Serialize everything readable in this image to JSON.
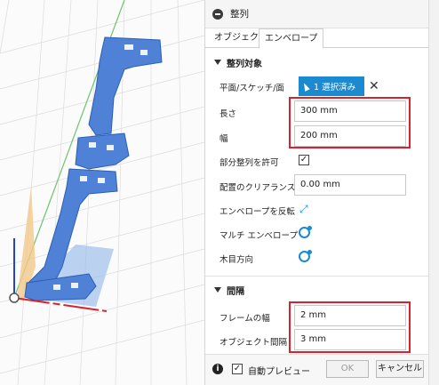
{
  "panel": {
    "title": "整列",
    "tabs": [
      "オブジェクト",
      "エンベロープ"
    ],
    "active_tab": 1
  },
  "section_target": {
    "header": "整列対象",
    "plane_label": "平面/スケッチ/面",
    "select_button": "1 選択済み",
    "clear_icon": "close-icon",
    "length_label": "長さ",
    "length_value": "300 mm",
    "width_label": "幅",
    "width_value": "200 mm",
    "partial_label": "部分整列を許可",
    "partial_checked": true,
    "clearance_label": "配置のクリアランス",
    "clearance_value": "0.00 mm",
    "flip_label": "エンベロープを反転",
    "multi_label": "マルチ エンベロープ",
    "grain_label": "木目方向"
  },
  "section_spacing": {
    "header": "間隔",
    "frame_label": "フレームの幅",
    "frame_value": "2 mm",
    "object_label": "オブジェクト間隔",
    "object_value": "3 mm"
  },
  "footer": {
    "preview_label": "自動プレビュー",
    "preview_checked": true,
    "ok": "OK",
    "cancel": "キャンセル"
  },
  "colors": {
    "accent": "#1c8ad1",
    "highlight": "#d7222f",
    "part": "#4f81d6",
    "envelope": "#8fb5e8"
  }
}
